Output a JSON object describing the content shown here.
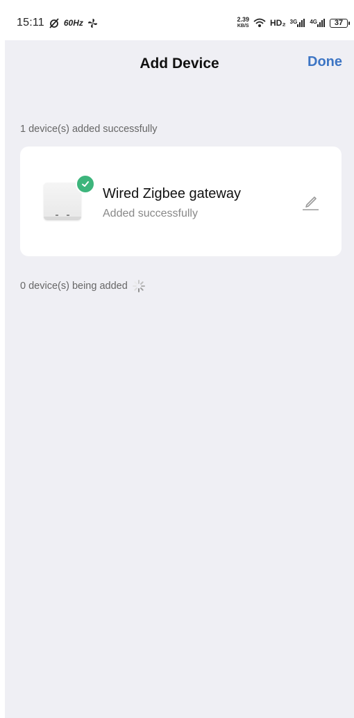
{
  "status_bar": {
    "time": "15:11",
    "refresh_rate": "60Hz",
    "net_speed_value": "2.39",
    "net_speed_unit": "KB/S",
    "hd_label": "HD₂",
    "signal1_label": "3G",
    "signal2_label": "4G",
    "battery": "37"
  },
  "nav": {
    "title": "Add Device",
    "done_label": "Done"
  },
  "added_section": {
    "label": "1 device(s) added successfully"
  },
  "device": {
    "name": "Wired Zigbee gateway",
    "status": "Added successfully"
  },
  "adding_section": {
    "label": "0 device(s) being added"
  },
  "colors": {
    "accent": "#3d75c4",
    "success": "#3db57c",
    "background": "#efeff4"
  }
}
